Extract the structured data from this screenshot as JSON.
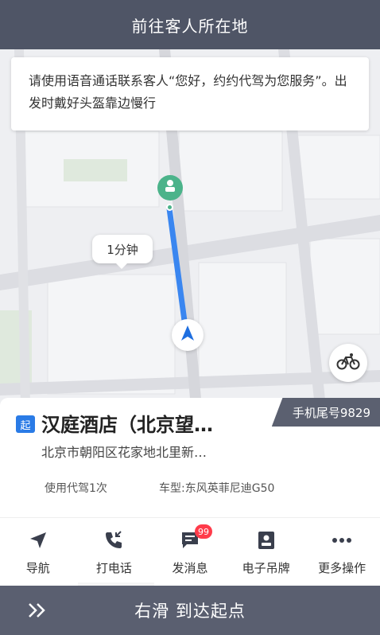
{
  "header": {
    "title": "前往客人所在地"
  },
  "notice": {
    "text": "请使用语音通话联系客人“您好，约约代驾为您服务”。出发时戴好头盔靠边慢行"
  },
  "map": {
    "eta": "1分钟"
  },
  "trip": {
    "phone_tail": "手机尾号9829",
    "start_badge": "起",
    "place_name": "汉庭酒店（北京望…",
    "address": "北京市朝阳区花家地北里新…",
    "usage": "使用代驾1次",
    "car_model": "车型:东风英菲尼迪G50"
  },
  "actions": [
    {
      "label": "导航",
      "icon": "navigation-arrow-icon"
    },
    {
      "label": "打电话",
      "icon": "phone-icon"
    },
    {
      "label": "发消息",
      "icon": "message-icon",
      "badge": "99"
    },
    {
      "label": "电子吊牌",
      "icon": "badge-card-icon"
    },
    {
      "label": "更多操作",
      "icon": "more-dots-icon"
    }
  ],
  "slide": {
    "text": "右滑 到达起点"
  },
  "colors": {
    "header": "#4f5566",
    "route": "#3a86f0",
    "accent_blue": "#2a7be6",
    "pin": "#4bb38a",
    "badge_red": "#ff3b4a"
  }
}
